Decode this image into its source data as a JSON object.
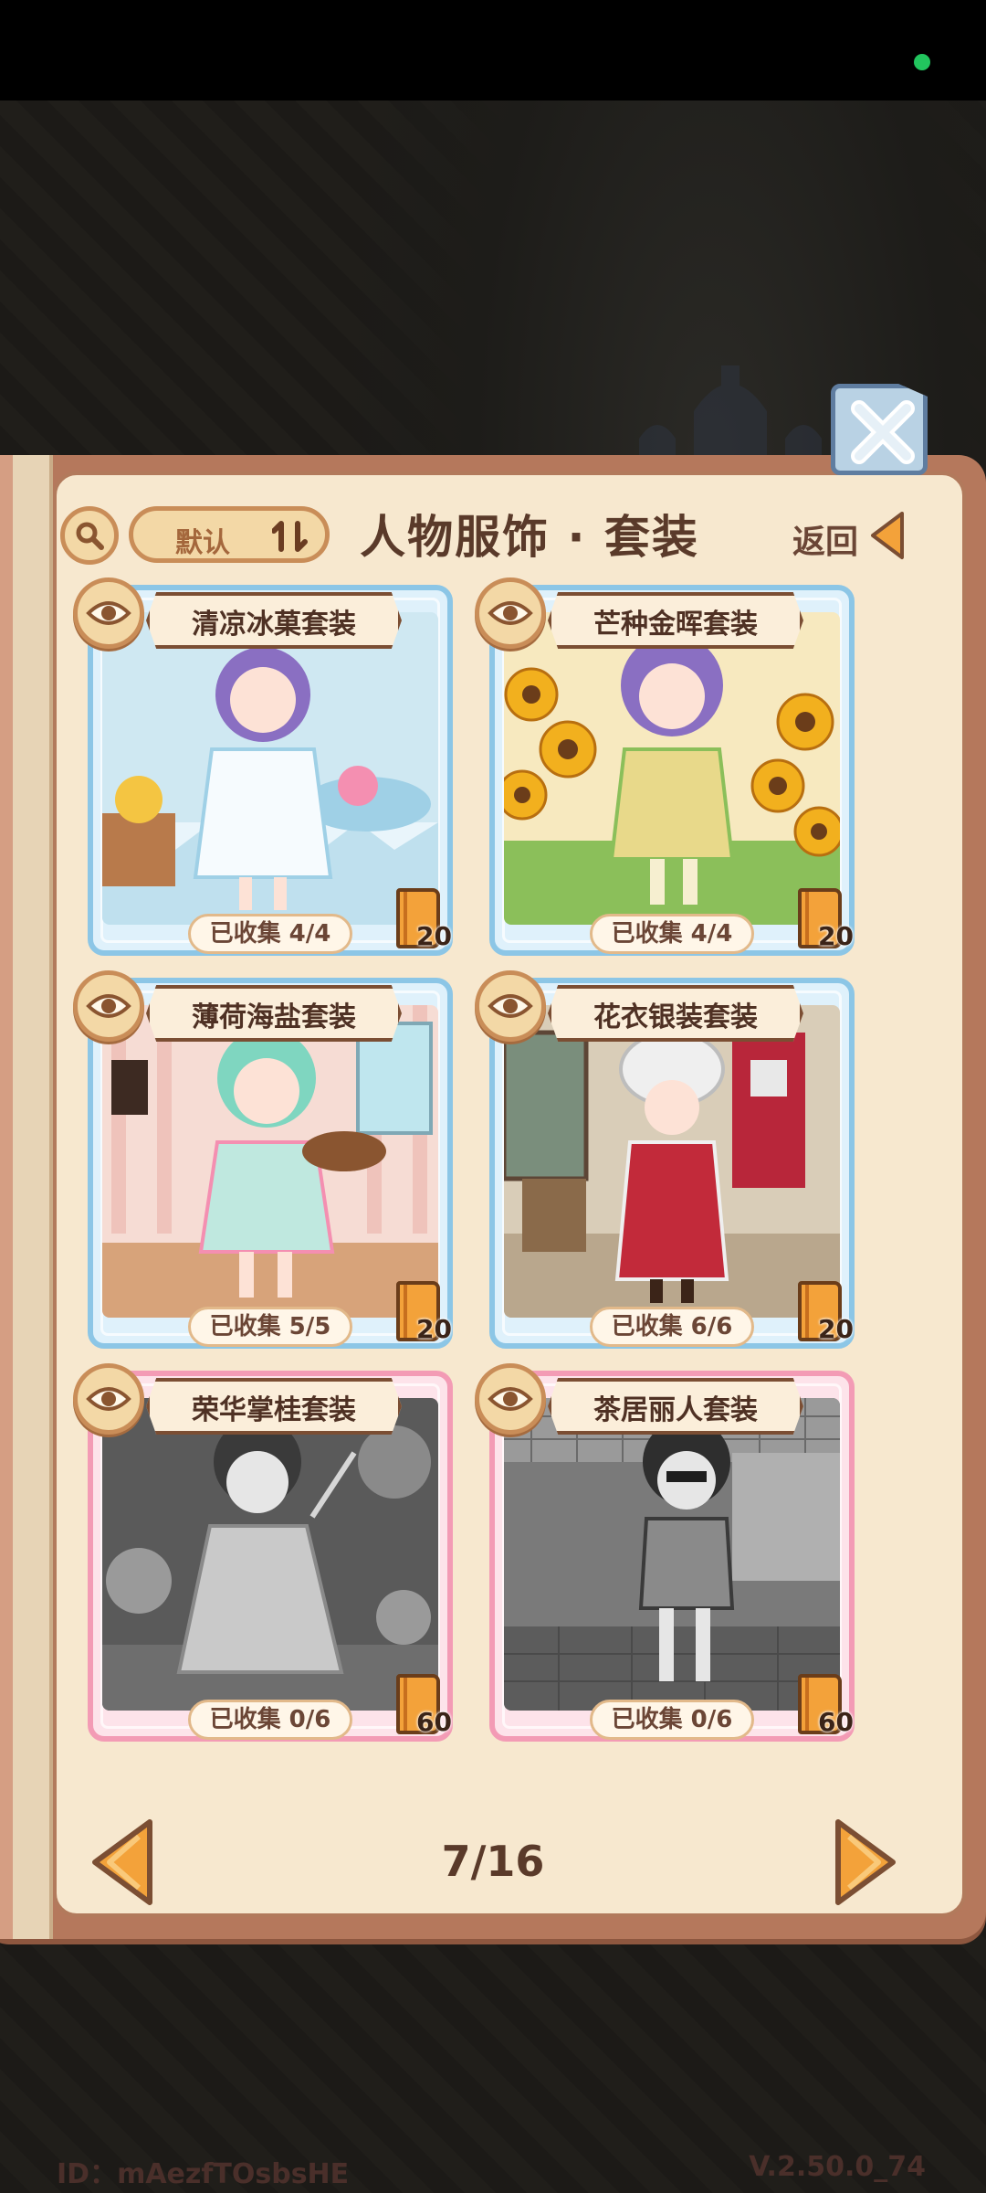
{
  "header": {
    "title": "人物服饰 · 套装",
    "sort_label": "默认",
    "back_label": "返回"
  },
  "cards": [
    {
      "name": "清凉冰菓套装",
      "collected": "已收集 4/4",
      "reward": "20",
      "frame": "#8cc6e6"
    },
    {
      "name": "芒种金晖套装",
      "collected": "已收集 4/4",
      "reward": "20",
      "frame": "#8cc6e6"
    },
    {
      "name": "薄荷海盐套装",
      "collected": "已收集 5/5",
      "reward": "20",
      "frame": "#8cc6e6"
    },
    {
      "name": "花衣银装套装",
      "collected": "已收集 6/6",
      "reward": "20",
      "frame": "#8cc6e6"
    },
    {
      "name": "荣华掌桂套装",
      "collected": "已收集 0/6",
      "reward": "60",
      "frame": "#f39bb5"
    },
    {
      "name": "茶居丽人套装",
      "collected": "已收集 0/6",
      "reward": "60",
      "frame": "#f39bb5"
    }
  ],
  "pagination": {
    "indicator": "7/16"
  },
  "footer": {
    "id": "ID：mAezfTOsbsHE",
    "version": "V.2.50.0_74"
  },
  "icons": {
    "close": "close-icon",
    "search": "search-icon",
    "sort": "sort-icon",
    "back": "back-arrow-icon",
    "eye": "eye-icon",
    "book": "book-icon",
    "prev": "prev-arrow-icon",
    "next": "next-arrow-icon"
  }
}
